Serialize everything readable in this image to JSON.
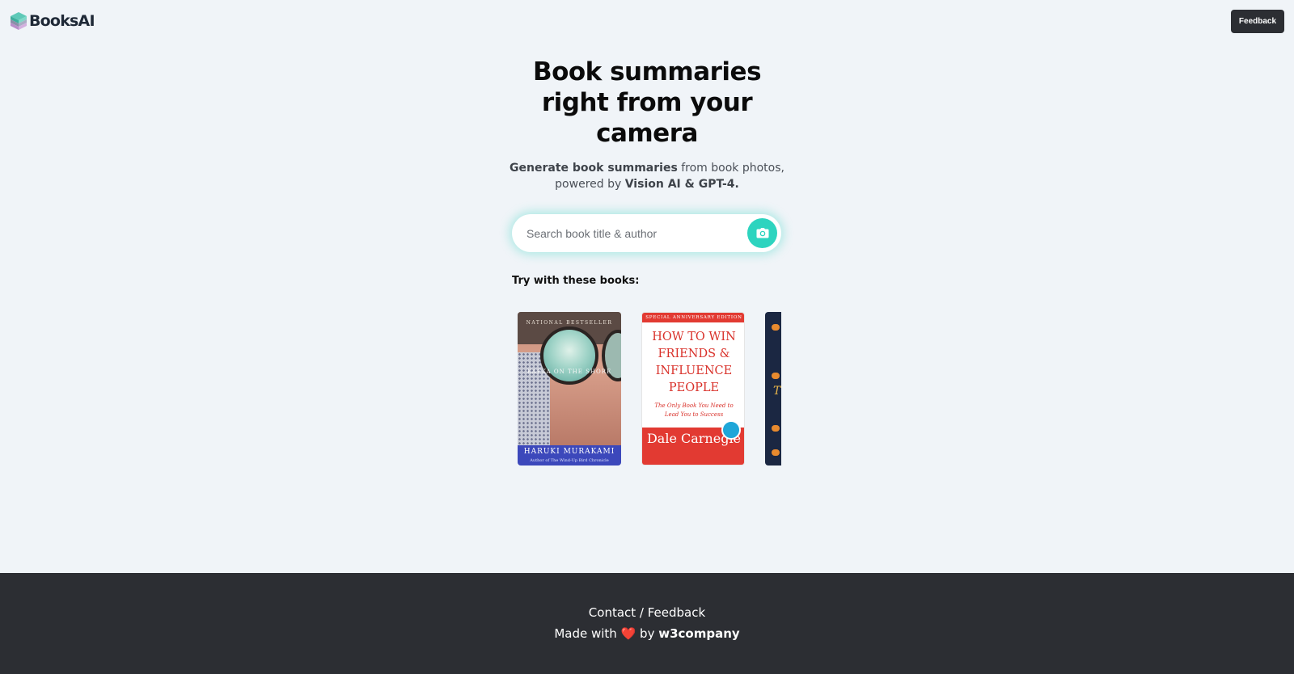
{
  "header": {
    "logo_text": "BooksAI",
    "feedback_label": "Feedback"
  },
  "hero": {
    "title": "Book summaries right from your camera",
    "subtitle_bold_1": "Generate book summaries",
    "subtitle_text_1": " from book photos, powered by ",
    "subtitle_bold_2": "Vision AI & GPT-4."
  },
  "search": {
    "placeholder": "Search book title & author",
    "icon": "camera-icon"
  },
  "suggestions": {
    "label": "Try with these books:",
    "books": [
      {
        "top_text": "NATIONAL BESTSELLER",
        "cover_title": "KAFKA ON THE SHORE",
        "author": "HARUKI MURAKAMI",
        "byline": "Author of The Wind-Up Bird Chronicle"
      },
      {
        "edition": "SPECIAL ANNIVERSARY EDITION",
        "cover_title": "HOW TO WIN FRIENDS & INFLUENCE PEOPLE",
        "tagline": "The Only Book You Need to Lead You to Success",
        "author": "Dale Carnegie"
      },
      {
        "cover_letter": "T"
      }
    ]
  },
  "footer": {
    "contact_label": "Contact / Feedback",
    "made_with": "Made with",
    "heart": "❤️",
    "by": "by",
    "company": "w3company"
  },
  "colors": {
    "accent": "#2dd4bf",
    "footer_bg": "#2c2e33",
    "page_bg": "#f0f4f8"
  }
}
